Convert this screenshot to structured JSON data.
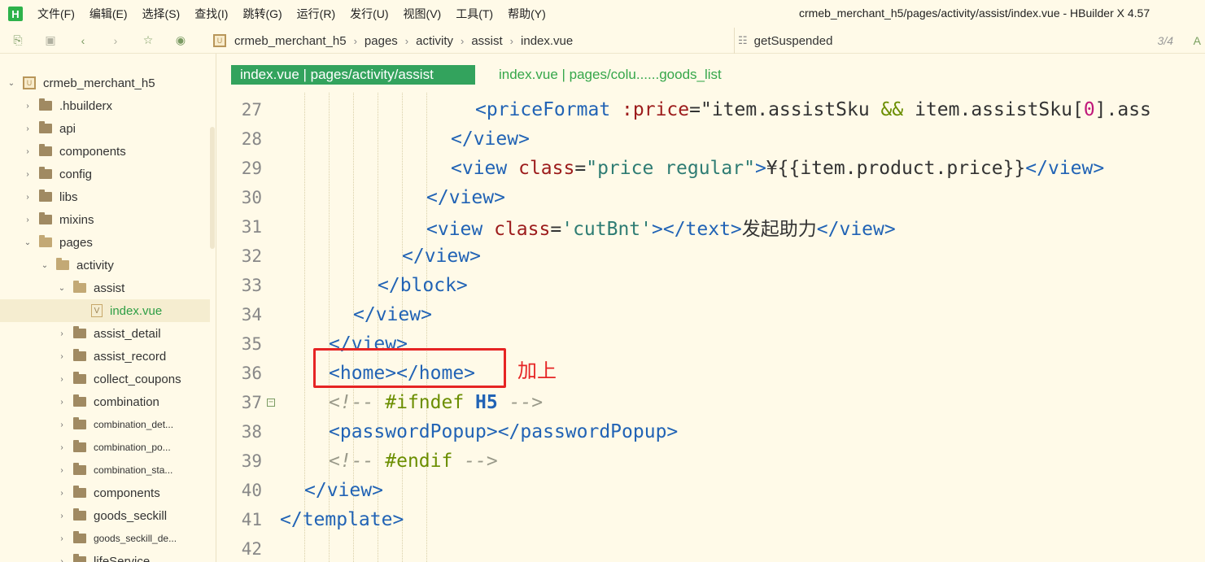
{
  "app": {
    "logo_letter": "H",
    "window_title": "crmeb_merchant_h5/pages/activity/assist/index.vue - HBuilder X 4.57"
  },
  "menu": [
    "文件(F)",
    "编辑(E)",
    "选择(S)",
    "查找(I)",
    "跳转(G)",
    "运行(R)",
    "发行(U)",
    "视图(V)",
    "工具(T)",
    "帮助(Y)"
  ],
  "breadcrumb": {
    "icon_text": "U",
    "items": [
      "crmeb_merchant_h5",
      "pages",
      "activity",
      "assist",
      "index.vue"
    ]
  },
  "function_search": {
    "value": "getSuspended",
    "count": "3/4",
    "more": "A"
  },
  "sidebar": {
    "project": "crmeb_merchant_h5",
    "items": [
      {
        "label": ".hbuilderx"
      },
      {
        "label": "api"
      },
      {
        "label": "components"
      },
      {
        "label": "config"
      },
      {
        "label": "libs"
      },
      {
        "label": "mixins"
      },
      {
        "label": "pages"
      },
      {
        "label": "activity"
      },
      {
        "label": "assist"
      },
      {
        "label": "index.vue"
      },
      {
        "label": "assist_detail"
      },
      {
        "label": "assist_record"
      },
      {
        "label": "collect_coupons"
      },
      {
        "label": "combination"
      },
      {
        "label": "combination_det..."
      },
      {
        "label": "combination_po..."
      },
      {
        "label": "combination_sta..."
      },
      {
        "label": "components"
      },
      {
        "label": "goods_seckill"
      },
      {
        "label": "goods_seckill_de..."
      },
      {
        "label": "lifeService"
      }
    ]
  },
  "tabs": {
    "active": "index.vue | pages/activity/assist",
    "inactive": "index.vue | pages/colu......goods_list"
  },
  "code": {
    "line_numbers": [
      "27",
      "28",
      "29",
      "30",
      "31",
      "32",
      "33",
      "34",
      "35",
      "36",
      "37",
      "38",
      "39",
      "40",
      "41",
      "42"
    ],
    "l27": {
      "tag": "<priceFormat",
      "attr": ":price",
      "eq": "=\"",
      "text": "item.assistSku ",
      "op": "&&",
      "text2": " item.assistSku[",
      "num": "0",
      "text3": "].ass"
    },
    "l28": "</view>",
    "l29": {
      "open": "<view",
      "attr": "class",
      "eq": "=",
      "str": "\"price regular\"",
      "close": ">",
      "text": "¥{{item.product.price}}",
      "end": "</view>"
    },
    "l30": "</view>",
    "l31": {
      "open": "<view",
      "attr": "class",
      "eq": "=",
      "str": "'cutBnt'",
      "close": "></text>",
      "text": "发起助力",
      "end": "</view>"
    },
    "l32": "</view>",
    "l33": "</block>",
    "l34": "</view>",
    "l35": "</view>",
    "l36": "<home></home>",
    "l37": {
      "com_open": "<!-- ",
      "dir": "#ifndef ",
      "kw": "H5",
      "com_close": " -->"
    },
    "l38": "<passwordPopup></passwordPopup>",
    "l39": {
      "com_open": "<!-- ",
      "dir": "#endif",
      "com_close": " -->"
    },
    "l40": "</view>",
    "l41": "</template>",
    "l42": ""
  },
  "annotation": {
    "text": "加上",
    "color": "#e62424"
  }
}
